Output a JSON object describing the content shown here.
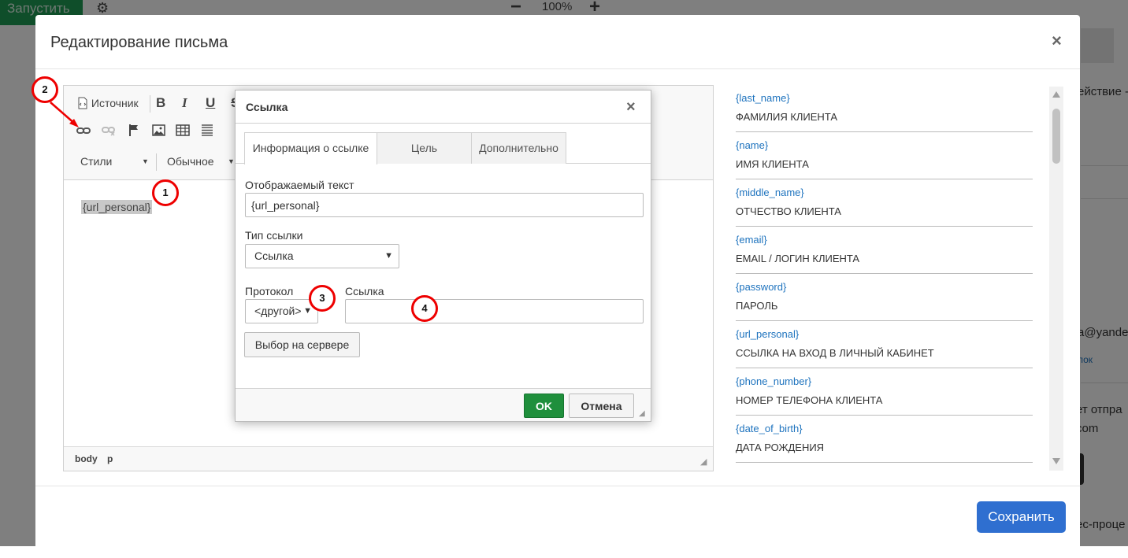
{
  "background": {
    "run_button": "Запустить",
    "gear_icon": "gear-icon",
    "zoom_minus": "−",
    "zoom_level": "100%",
    "zoom_plus": "+",
    "side_text_1": "ействие -",
    "side_text_2": "a@yande",
    "side_link": "лок",
    "side_text_3": "ет отпра",
    "side_text_4": "com",
    "side_text_5": "ес-проце"
  },
  "modal": {
    "title": "Редактирование письма",
    "close": "×",
    "save_label": "Сохранить",
    "save_color": "#2f6fd0"
  },
  "editor": {
    "toolbar": {
      "source_label": "Источник",
      "bold": "B",
      "italic": "I",
      "underline": "U",
      "strike": "S",
      "styles_combo": "Стили",
      "format_combo": "Обычное"
    },
    "content_text": "{url_personal}",
    "status_path": [
      "body",
      "p"
    ]
  },
  "variables": [
    {
      "code": "{last_name}",
      "desc": "ФАМИЛИЯ КЛИЕНТА"
    },
    {
      "code": "{name}",
      "desc": "ИМЯ КЛИЕНТА"
    },
    {
      "code": "{middle_name}",
      "desc": "ОТЧЕСТВО КЛИЕНТА"
    },
    {
      "code": "{email}",
      "desc": "EMAIL / ЛОГИН КЛИЕНТА"
    },
    {
      "code": "{password}",
      "desc": "ПАРОЛЬ"
    },
    {
      "code": "{url_personal}",
      "desc": "ССЫЛКА НА ВХОД В ЛИЧНЫЙ КАБИНЕТ"
    },
    {
      "code": "{phone_number}",
      "desc": "НОМЕР ТЕЛЕФОНА КЛИЕНТА"
    },
    {
      "code": "{date_of_birth}",
      "desc": "ДАТА РОЖДЕНИЯ"
    }
  ],
  "link_dialog": {
    "title": "Ссылка",
    "close": "×",
    "tabs": [
      {
        "label": "Информация о ссылке",
        "active": true
      },
      {
        "label": "Цель",
        "active": false
      },
      {
        "label": "Дополнительно",
        "active": false
      }
    ],
    "display_text_label": "Отображаемый текст",
    "display_text_value": "{url_personal}",
    "link_type_label": "Тип ссылки",
    "link_type_value": "Ссылка",
    "protocol_label": "Протокол",
    "protocol_value": "<другой>",
    "url_label": "Ссылка",
    "url_value": "",
    "server_button": "Выбор на сервере",
    "ok_label": "OK",
    "cancel_label": "Отмена",
    "ok_color": "#1f8f3c"
  },
  "annotations": [
    "1",
    "2",
    "3",
    "4"
  ],
  "annotation_color": "#e00000"
}
